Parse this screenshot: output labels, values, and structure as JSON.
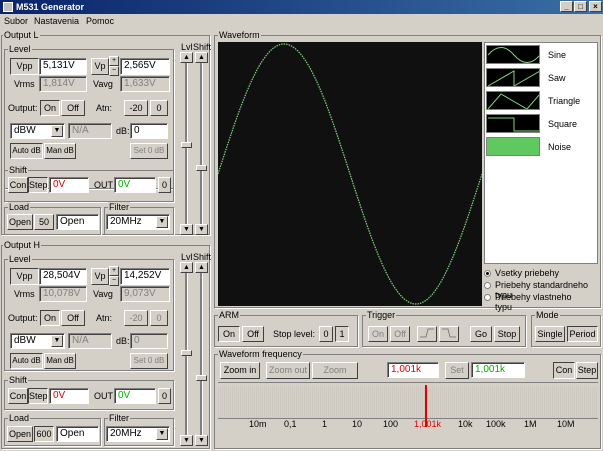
{
  "window": {
    "title": "M531 Generator",
    "min": "_",
    "max": "□",
    "close": "×"
  },
  "menu": [
    "Subor",
    "Nastavenia",
    "Pomoc"
  ],
  "outL": {
    "title": "Output L",
    "level": "Level",
    "vpp_l": "Vpp",
    "vpp": "5,131V",
    "vp_l": "Vp",
    "vp": "2,565V",
    "vrms_l": "Vrms",
    "vrms": "1,814V",
    "vavg_l": "Vavg",
    "vavg": "1,633V",
    "output": "Output:",
    "on": "On",
    "off": "Off",
    "atn": "Atn:",
    "atn1": "-20",
    "atn2": "0",
    "unit": "dBW",
    "na": "N/A",
    "db_l": "dB:",
    "db": "0",
    "autodb": "Auto dB",
    "mandb": "Man dB",
    "set0": "Set 0 dB",
    "shift": "Shift",
    "con": "Con",
    "step": "Step",
    "shiftv": "0V",
    "out": "OUT",
    "outv": "0V",
    "outn": "0",
    "load": "Load",
    "open": "Open",
    "loadn": "50",
    "loadv": "Open",
    "filter": "Filter",
    "filterv": "20MHz",
    "lvl": "Lvl",
    "shiftcol": "Shift"
  },
  "outH": {
    "title": "Output H",
    "level": "Level",
    "vpp_l": "Vpp",
    "vpp": "28,504V",
    "vp_l": "Vp",
    "vp": "14,252V",
    "vrms_l": "Vrms",
    "vrms": "10,078V",
    "vavg_l": "Vavg",
    "vavg": "9,073V",
    "output": "Output:",
    "on": "On",
    "off": "Off",
    "atn": "Atn:",
    "atn1": "-20",
    "atn2": "0",
    "unit": "dBW",
    "na": "N/A",
    "db_l": "dB:",
    "db": "0",
    "autodb": "Auto dB",
    "mandb": "Man dB",
    "set0": "Set 0 dB",
    "shift": "Shift",
    "con": "Con",
    "step": "Step",
    "shiftv": "0V",
    "out": "OUT",
    "outv": "0V",
    "outn": "0",
    "load": "Load",
    "open": "Open",
    "loadn": "600",
    "loadv": "Open",
    "filter": "Filter",
    "filterv": "20MHz",
    "lvl": "Lvl",
    "shiftcol": "Shift"
  },
  "waveform": {
    "title": "Waveform",
    "types": [
      "Sine",
      "Saw",
      "Triangle",
      "Square",
      "Noise"
    ],
    "radios": [
      "Vsetky priebehy",
      "Priebehy standardneho typu",
      "Priebehy vlastneho typu"
    ],
    "trace_color": "#7fd67f"
  },
  "arm": {
    "title": "ARM",
    "on": "On",
    "off": "Off",
    "stop": "Stop level:",
    "v0": "0",
    "v1": "1"
  },
  "trigger": {
    "title": "Trigger",
    "on": "On",
    "off": "Off",
    "go": "Go",
    "stop": "Stop"
  },
  "mode": {
    "title": "Mode",
    "single": "Single",
    "period": "Period"
  },
  "freq": {
    "title": "Waveform frequency",
    "zin": "Zoom in",
    "zout": "Zoom out",
    "zaway": "Zoom away",
    "f1": "1,001k",
    "set": "Set",
    "f2": "1,001k",
    "con": "Con",
    "step": "Step",
    "ticks": [
      "10m",
      "0,1",
      "1",
      "10",
      "100",
      "1,001k",
      "10k",
      "100k",
      "1M",
      "10M"
    ]
  }
}
